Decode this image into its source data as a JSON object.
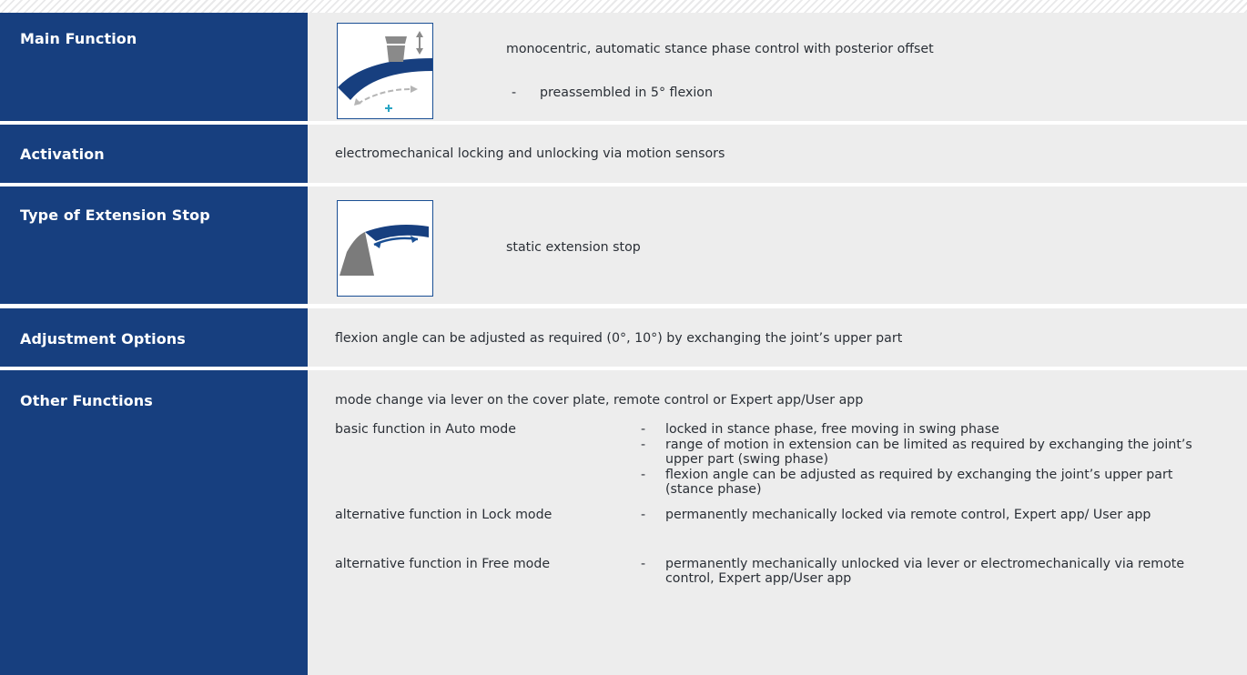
{
  "rows": {
    "main_function": {
      "label": "Main Function",
      "description": "monocentric, automatic stance phase control with posterior offset",
      "bullet": "preassembled in 5° flexion",
      "icon": "knee-joint-stance-control-icon"
    },
    "activation": {
      "label": "Activation",
      "description": "electromechanical locking and unlocking via motion sensors"
    },
    "extension_stop": {
      "label": "Type of Extension Stop",
      "description": "static extension stop",
      "icon": "static-extension-stop-icon"
    },
    "adjustment": {
      "label": "Adjustment Options",
      "description": "flexion angle can be adjusted as required (0°, 10°) by exchanging the joint’s upper part"
    },
    "other": {
      "label": "Other Functions",
      "intro": "mode change via lever on the cover plate, remote control or Expert app/User app",
      "modes": [
        {
          "name": "basic function in Auto mode",
          "items": [
            "locked in stance phase, free moving in swing phase",
            "range of motion in extension can be limited as required by exchanging the joint’s upper part (swing phase)",
            "flexion angle can be adjusted as required by exchanging the joint’s upper part (stance phase)"
          ]
        },
        {
          "name": "alternative function in Lock mode",
          "items": [
            "permanently mechanically locked via remote control, Expert app/ User app"
          ]
        },
        {
          "name": "alternative function in Free mode",
          "items": [
            "permanently mechanically unlocked via lever or electromechanically via remote control, Expert app/User app"
          ]
        }
      ]
    }
  },
  "dash": "-",
  "colors": {
    "label_bg": "#173f7f",
    "row_bg": "#ededed",
    "icon_blue": "#1a4f94",
    "icon_cyan": "#2aa5c4",
    "icon_gray": "#7b7b7b"
  }
}
